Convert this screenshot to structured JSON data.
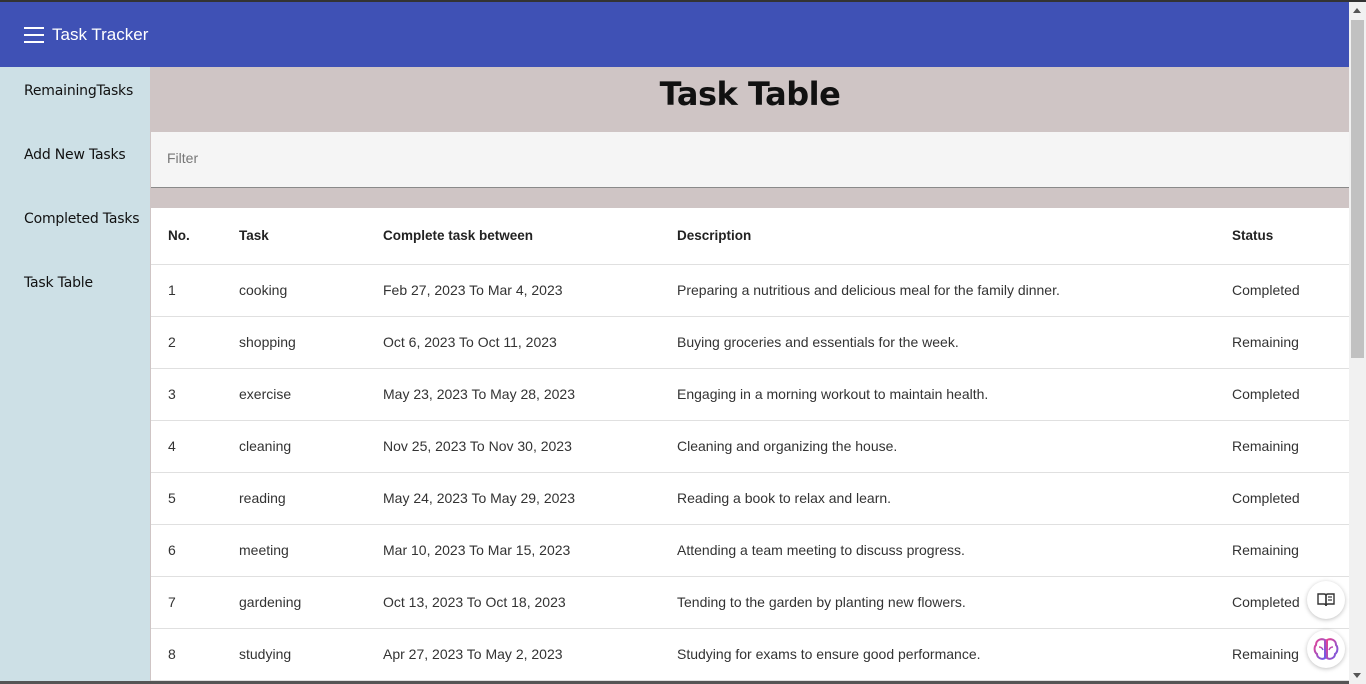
{
  "app": {
    "title": "Task Tracker"
  },
  "sidebar": {
    "items": [
      {
        "label": "RemainingTasks"
      },
      {
        "label": "Add New Tasks"
      },
      {
        "label": "Completed Tasks"
      },
      {
        "label": "Task Table"
      }
    ]
  },
  "main": {
    "title": "Task Table",
    "filter": {
      "placeholder": "Filter",
      "value": ""
    },
    "table": {
      "headers": [
        "No.",
        "Task",
        "Complete task between",
        "Description",
        "Status"
      ],
      "rows": [
        {
          "no": "1",
          "task": "cooking",
          "range": "Feb 27, 2023 To Mar 4, 2023",
          "description": "Preparing a nutritious and delicious meal for the family dinner.",
          "status": "Completed"
        },
        {
          "no": "2",
          "task": "shopping",
          "range": "Oct 6, 2023 To Oct 11, 2023",
          "description": "Buying groceries and essentials for the week.",
          "status": "Remaining"
        },
        {
          "no": "3",
          "task": "exercise",
          "range": "May 23, 2023 To May 28, 2023",
          "description": "Engaging in a morning workout to maintain health.",
          "status": "Completed"
        },
        {
          "no": "4",
          "task": "cleaning",
          "range": "Nov 25, 2023 To Nov 30, 2023",
          "description": "Cleaning and organizing the house.",
          "status": "Remaining"
        },
        {
          "no": "5",
          "task": "reading",
          "range": "May 24, 2023 To May 29, 2023",
          "description": "Reading a book to relax and learn.",
          "status": "Completed"
        },
        {
          "no": "6",
          "task": "meeting",
          "range": "Mar 10, 2023 To Mar 15, 2023",
          "description": "Attending a team meeting to discuss progress.",
          "status": "Remaining"
        },
        {
          "no": "7",
          "task": "gardening",
          "range": "Oct 13, 2023 To Oct 18, 2023",
          "description": "Tending to the garden by planting new flowers.",
          "status": "Completed"
        },
        {
          "no": "8",
          "task": "studying",
          "range": "Apr 27, 2023 To May 2, 2023",
          "description": "Studying for exams to ensure good performance.",
          "status": "Remaining"
        }
      ]
    }
  },
  "colors": {
    "appbar": "#3f51b5",
    "sidebar": "#cde0e6",
    "background": "#cfc5c5"
  },
  "floating_buttons": [
    {
      "icon": "reader-mode-icon"
    },
    {
      "icon": "brain-icon"
    }
  ]
}
